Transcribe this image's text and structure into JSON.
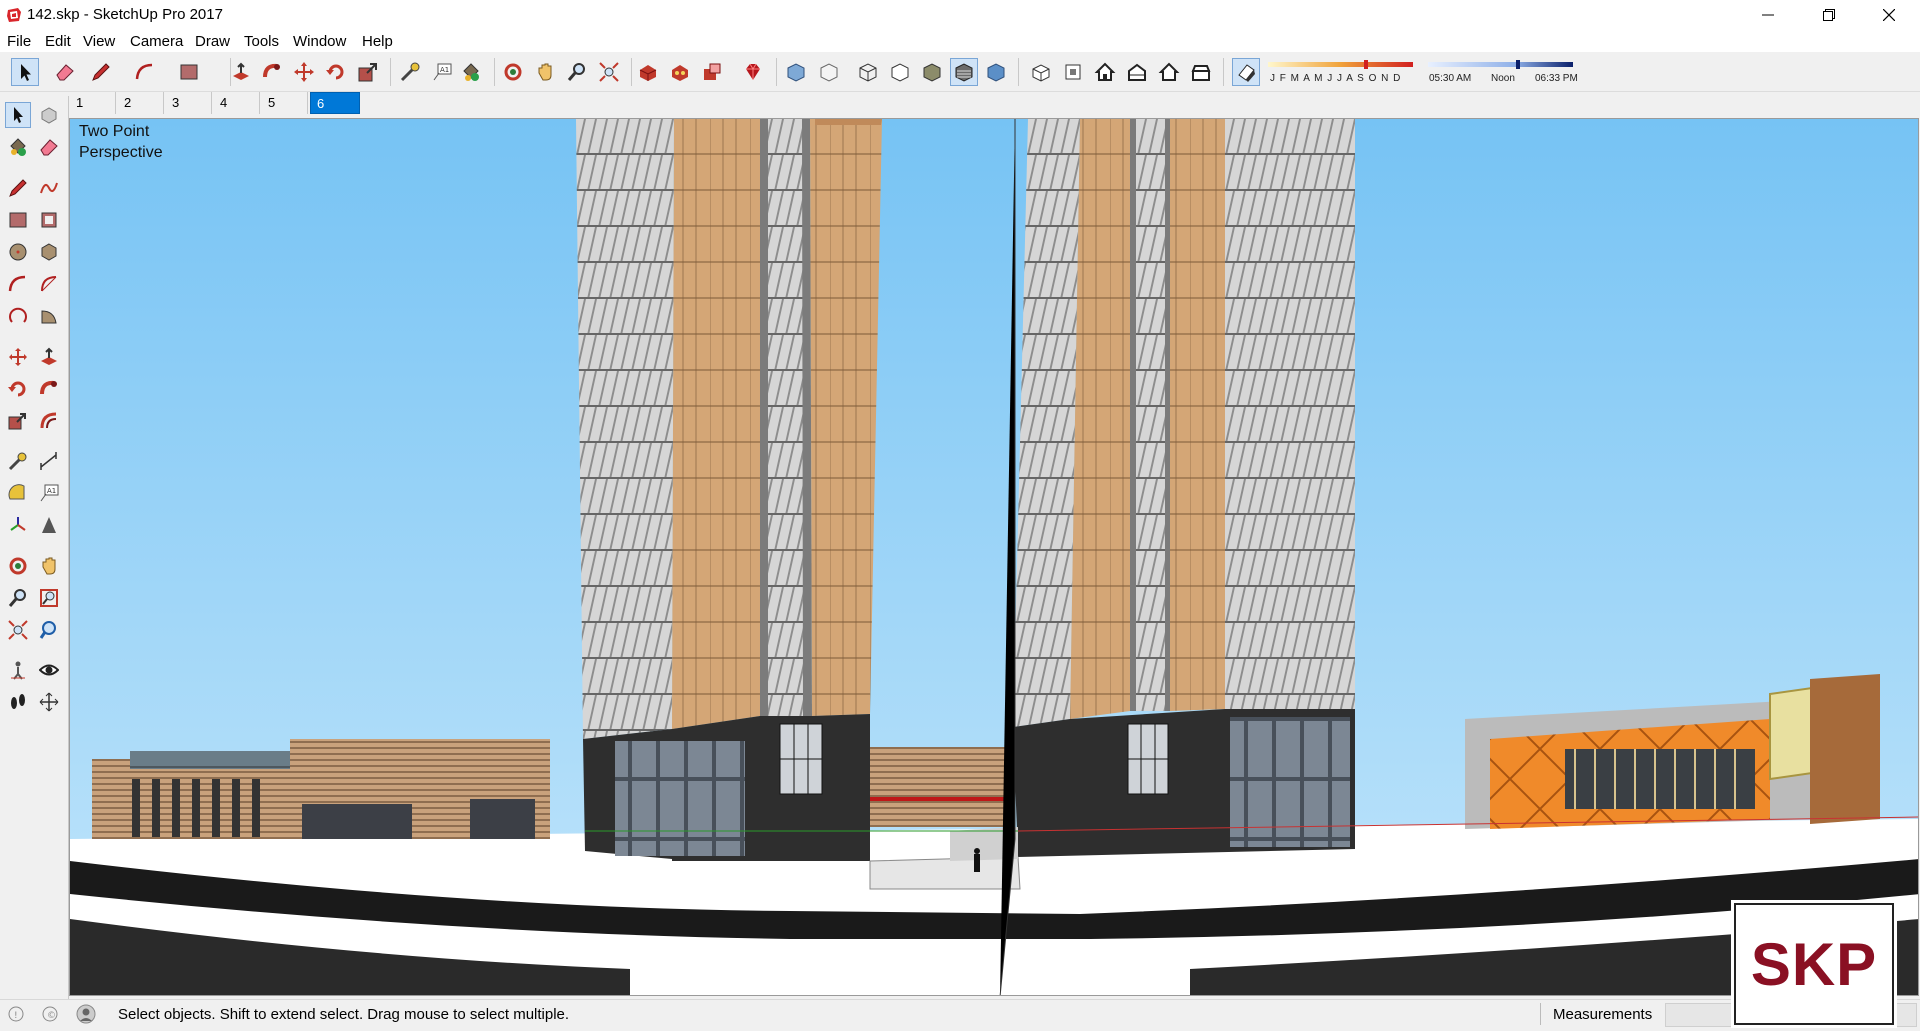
{
  "window": {
    "title": "142.skp - SketchUp Pro 2017"
  },
  "menu": [
    "File",
    "Edit",
    "View",
    "Camera",
    "Draw",
    "Tools",
    "Window",
    "Help"
  ],
  "toolbar_icons": [
    "select-icon",
    "eraser-icon",
    "pencil-icon",
    "arc-icon",
    "rectangle-icon",
    "push-pull-icon",
    "follow-me-icon",
    "move-icon",
    "rotate-icon",
    "scale-icon",
    "tape-measure-icon",
    "text-icon",
    "paint-bucket-icon",
    "orbit-icon",
    "pan-icon",
    "zoom-icon",
    "zoom-extents-icon",
    "3d-warehouse-icon",
    "extension-warehouse-icon",
    "share-model-icon",
    "ruby-icon",
    "xray-icon",
    "back-edges-icon",
    "wireframe-icon",
    "hidden-line-icon",
    "shaded-icon",
    "shaded-textures-icon",
    "monochrome-icon",
    "iso-view-icon",
    "top-view-icon",
    "front-view-icon",
    "right-view-icon",
    "back-view-icon",
    "left-view-icon",
    "shadows-icon"
  ],
  "shadows": {
    "months": "J F M A M J J A S O N D",
    "sunrise": "05:30 AM",
    "noon": "Noon",
    "sunset": "06:33 PM"
  },
  "scenes": [
    "1",
    "2",
    "3",
    "4",
    "5",
    "6"
  ],
  "active_scene": "6",
  "palette_icons": [
    "select-icon",
    "component-icon",
    "paint-bucket-icon",
    "eraser-icon",
    "line-icon",
    "freehand-icon",
    "rectangle-icon",
    "rotated-rectangle-icon",
    "circle-icon",
    "polygon-icon",
    "arc-icon",
    "two-point-arc-icon",
    "three-point-arc-icon",
    "pie-icon",
    "move-icon",
    "push-pull-icon",
    "rotate-icon",
    "follow-me-icon",
    "scale-icon",
    "offset-icon",
    "tape-measure-icon",
    "dimension-icon",
    "protractor-icon",
    "text-icon",
    "axes-icon",
    "3d-text-icon",
    "orbit-icon",
    "pan-icon",
    "zoom-icon",
    "zoom-window-icon",
    "zoom-extents-icon",
    "previous-icon",
    "position-camera-icon",
    "look-around-icon",
    "walk-icon",
    "section-plane-icon"
  ],
  "viewport": {
    "camera_label": "Two Point Perspective"
  },
  "status": {
    "message": "Select objects. Shift to extend select. Drag mouse to select multiple.",
    "measurements_label": "Measurements"
  },
  "logo": {
    "text": "SKP"
  },
  "colors": {
    "sky_top": "#76c3f4",
    "sky_bottom": "#b9e1fa",
    "selection_blue": "#0078d7",
    "skp_red": "#8a1023"
  }
}
